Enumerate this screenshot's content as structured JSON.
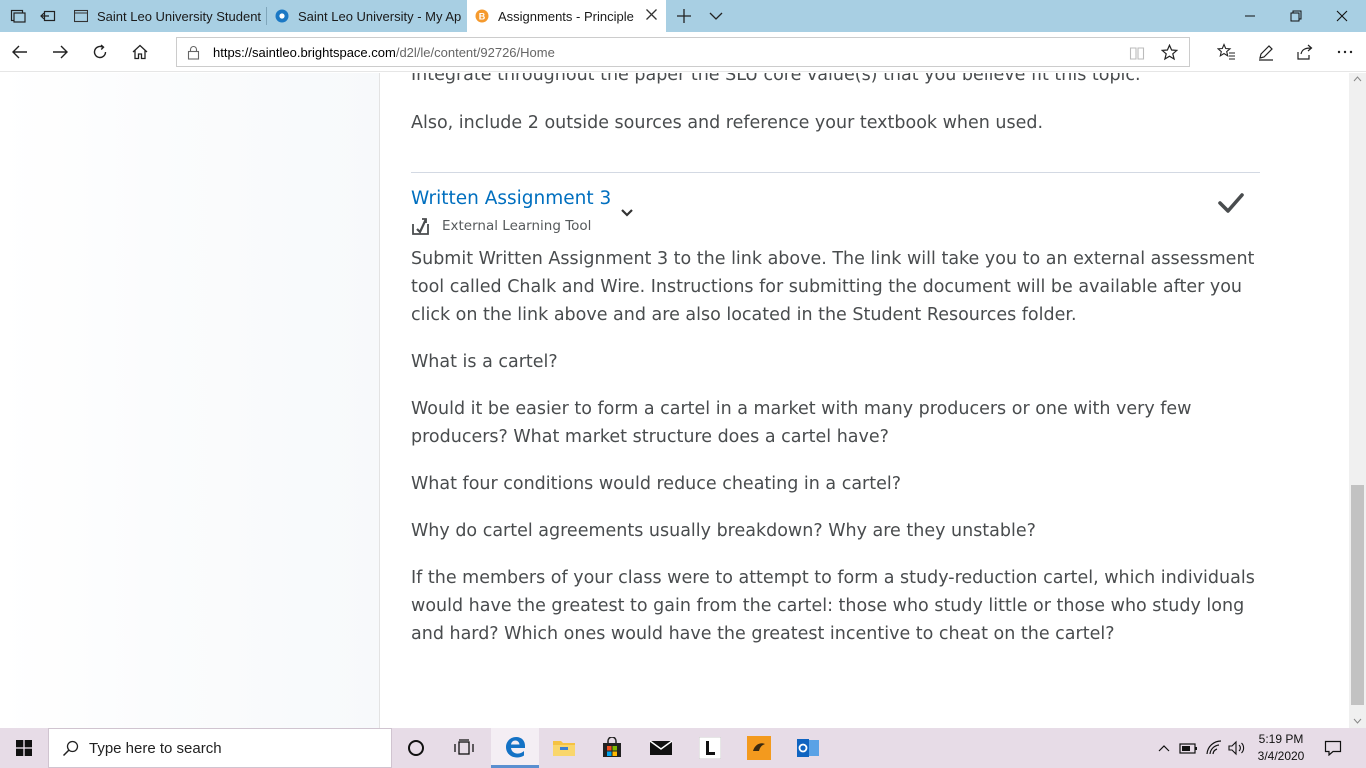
{
  "browser": {
    "tabs": [
      {
        "title": "Saint Leo University Student",
        "active": false
      },
      {
        "title": "Saint Leo University - My Ap",
        "active": false
      },
      {
        "title": "Assignments - Principle",
        "active": true
      }
    ],
    "url_host": "https://saintleo.brightspace.com",
    "url_path": "/d2l/le/content/92726/Home"
  },
  "page": {
    "top_cut_text": "Integrate throughout the paper the SLU core value(s) that you believe fit this topic.",
    "intro_text": "Also, include 2 outside sources and reference your textbook when used.",
    "item": {
      "title": "Written Assignment 3",
      "subtitle": "External Learning Tool",
      "completed": true
    },
    "paragraphs": [
      "Submit Written Assignment 3 to the link above. The link will take you to an external assessment tool called Chalk and Wire. Instructions for submitting the document will be available after you click on the link above and are also located in the Student Resources folder.",
      "What is a cartel?",
      "Would it be easier to form a cartel in a market with many producers or one with very few producers?  What market structure does a cartel have?",
      "What four conditions would reduce cheating in a cartel?",
      "Why do cartel agreements usually breakdown?  Why are they unstable?",
      "If the members of your class were to attempt to form a study-reduction cartel, which individuals would have the greatest to gain from the cartel: those who study little or those who study long and hard?  Which ones would have the greatest incentive to cheat on the cartel?"
    ]
  },
  "taskbar": {
    "search_placeholder": "Type here to search",
    "time": "5:19 PM",
    "date": "3/4/2020"
  },
  "colors": {
    "title_bar": "#a8cfe3",
    "link": "#006fbf",
    "body_text": "#494c4e",
    "taskbar": "#e7dce7"
  }
}
